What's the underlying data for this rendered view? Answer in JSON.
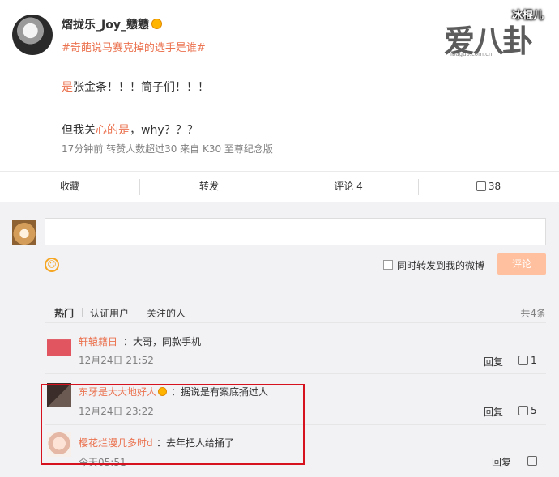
{
  "post": {
    "username": "熠拢乐_Joy_戆戆",
    "topic": "#奇葩说马赛克掉的选手是谁#",
    "line1_hl": "是",
    "line1_rest": "张金条！！！筒子们！！！",
    "line2_a": "但我关",
    "line2_hl": "心的是",
    "line2_b": "，why？？？",
    "meta": "17分钟前  转赞人数超过30  来自 K30 至尊纪念版"
  },
  "watermark": {
    "main": "爱八卦",
    "url": "ibaguo.com.cn",
    "tag": "冰棍儿"
  },
  "actions": {
    "collect": "收藏",
    "forward": "转发",
    "comment": "评论 4",
    "like": "38"
  },
  "composer": {
    "sync_label": "同时转发到我的微博",
    "submit": "评论",
    "emoji": "☺"
  },
  "filters": {
    "hot": "热门",
    "verified": "认证用户",
    "following": "关注的人",
    "total": "共4条"
  },
  "comments": [
    {
      "name": "轩辕籍日",
      "sep": "：",
      "text": "大哥，同款手机",
      "time": "12月24日 21:52",
      "reply": "回复",
      "likes": "1"
    },
    {
      "name": "东牙是大大地好人",
      "sep": "：",
      "text": "据说是有案底捅过人",
      "time": "12月24日 23:22",
      "reply": "回复",
      "likes": "5"
    },
    {
      "name": "樱花烂漫几多时d",
      "sep": "：",
      "text": "去年把人给捅了",
      "time": "今天05:51",
      "reply": "回复",
      "likes": ""
    }
  ],
  "colors": {
    "accent": "#eb7350",
    "highlight_box": "#d6121f",
    "submit_bg": "#ffc09f"
  }
}
